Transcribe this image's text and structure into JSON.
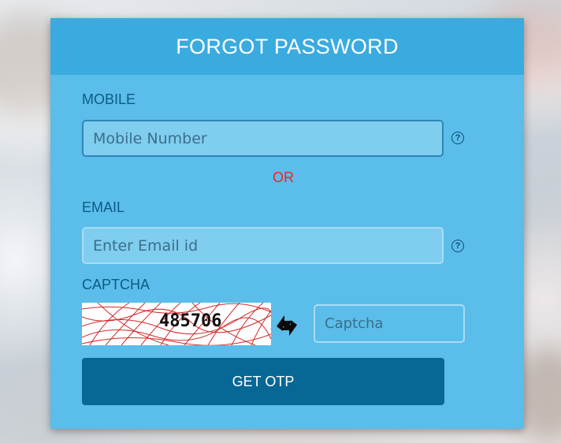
{
  "form": {
    "title": "FORGOT PASSWORD",
    "mobile": {
      "label": "MOBILE",
      "placeholder": "Mobile Number",
      "value": ""
    },
    "separator": "OR",
    "email": {
      "label": "EMAIL",
      "placeholder": "Enter Email id",
      "value": ""
    },
    "captcha": {
      "label": "CAPTCHA",
      "image_text": "485706",
      "input_placeholder": "Captcha",
      "input_value": ""
    },
    "submit_label": "GET OTP"
  },
  "icons": {
    "help": "question-circle-icon",
    "refresh": "refresh-arrows-icon"
  },
  "colors": {
    "panel": "#5bbde9",
    "header": "#3aabdf",
    "label": "#0d5a86",
    "separator": "#e8272b",
    "button": "#076896",
    "button_text": "#ffffff"
  }
}
